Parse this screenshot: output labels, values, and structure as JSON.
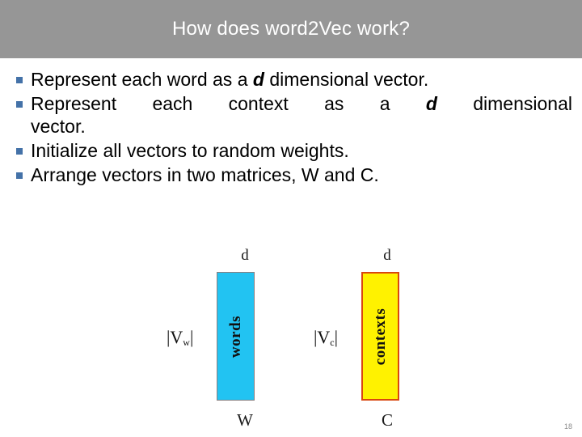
{
  "header": {
    "title": "How does word2Vec work?",
    "background_color": "#969696",
    "text_color": "#ffffff"
  },
  "bullets": [
    {
      "marker": "square-bullet-icon",
      "text_before": "Represent each word as a ",
      "emphasis": "d",
      "text_after": " dimensional vector.",
      "continuation": ""
    },
    {
      "marker": "square-bullet-icon",
      "text_before": "Represent each context as a ",
      "emphasis": "d",
      "text_after": " dimensional",
      "continuation": "vector."
    },
    {
      "marker": "square-bullet-icon",
      "text_before": "Initialize all vectors to random weights.",
      "emphasis": "",
      "text_after": "",
      "continuation": ""
    },
    {
      "marker": "square-bullet-icon",
      "text_before": "Arrange vectors in two matrices, W and C.",
      "emphasis": "",
      "text_after": "",
      "continuation": ""
    }
  ],
  "bullet_color": "#4472a8",
  "diagram": {
    "words_matrix": {
      "top_label": "d",
      "side_label": "|V",
      "side_label_sub": "w",
      "side_label_end": "|",
      "inner_label": "words",
      "bottom_label": "W",
      "fill_color": "#22c3f2",
      "border_color": "#8a7f80"
    },
    "contexts_matrix": {
      "top_label": "d",
      "side_label": "|V",
      "side_label_sub": "c",
      "side_label_end": "|",
      "inner_label": "contexts",
      "bottom_label": "C",
      "fill_color": "#fff200",
      "border_color": "#d9470f"
    }
  },
  "footer": {
    "page_number": "18"
  }
}
